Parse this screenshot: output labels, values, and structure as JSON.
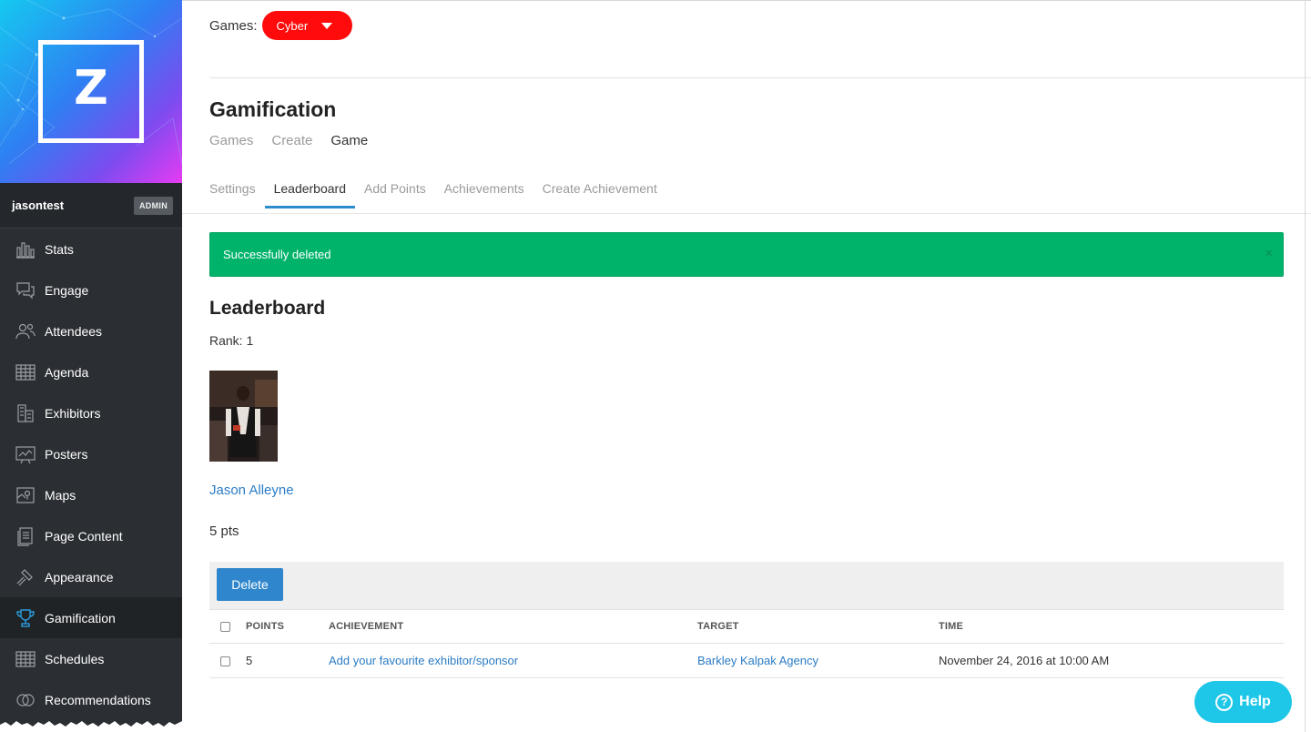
{
  "sidebar": {
    "logo_letter": "Z",
    "username": "jasontest",
    "role_badge": "ADMIN",
    "items": [
      {
        "label": "Stats",
        "icon": "bar-chart-icon"
      },
      {
        "label": "Engage",
        "icon": "chat-bubbles-icon"
      },
      {
        "label": "Attendees",
        "icon": "people-icon"
      },
      {
        "label": "Agenda",
        "icon": "calendar-grid-icon"
      },
      {
        "label": "Exhibitors",
        "icon": "buildings-icon"
      },
      {
        "label": "Posters",
        "icon": "presentation-board-icon"
      },
      {
        "label": "Maps",
        "icon": "map-icon"
      },
      {
        "label": "Page Content",
        "icon": "document-icon"
      },
      {
        "label": "Appearance",
        "icon": "hammer-icon"
      },
      {
        "label": "Gamification",
        "icon": "trophy-icon",
        "active": true
      },
      {
        "label": "Schedules",
        "icon": "calendar-grid-icon"
      },
      {
        "label": "Recommendations",
        "icon": "overlapping-circles-icon"
      }
    ]
  },
  "header": {
    "games_label": "Games:",
    "games_selected": "Cyber"
  },
  "page": {
    "title": "Gamification",
    "breadcrumbs": [
      "Games",
      "Create",
      "Game"
    ]
  },
  "tabs": [
    {
      "label": "Settings",
      "active": false
    },
    {
      "label": "Leaderboard",
      "active": true
    },
    {
      "label": "Add Points",
      "active": false
    },
    {
      "label": "Achievements",
      "active": false
    },
    {
      "label": "Create Achievement",
      "active": false
    }
  ],
  "alert": {
    "message": "Successfully deleted",
    "close": "×"
  },
  "leaderboard": {
    "title": "Leaderboard",
    "rank_text": "Rank: 1",
    "user_name": "Jason Alleyne",
    "points_text": "5 pts",
    "delete_label": "Delete",
    "columns": [
      "POINTS",
      "ACHIEVEMENT",
      "TARGET",
      "TIME"
    ],
    "rows": [
      {
        "points": "5",
        "achievement": "Add your favourite exhibitor/sponsor",
        "target": "Barkley Kalpak Agency",
        "time": "November 24, 2016 at 10:00 AM"
      }
    ]
  },
  "help": {
    "label": "Help"
  },
  "colors": {
    "sidebar_bg": "#2b2f33",
    "games_pill": "#ff0b0b",
    "alert_success": "#00b36b",
    "link": "#2b7cc4",
    "primary_button": "#2f86cc",
    "help_button": "#1ec7e8"
  }
}
